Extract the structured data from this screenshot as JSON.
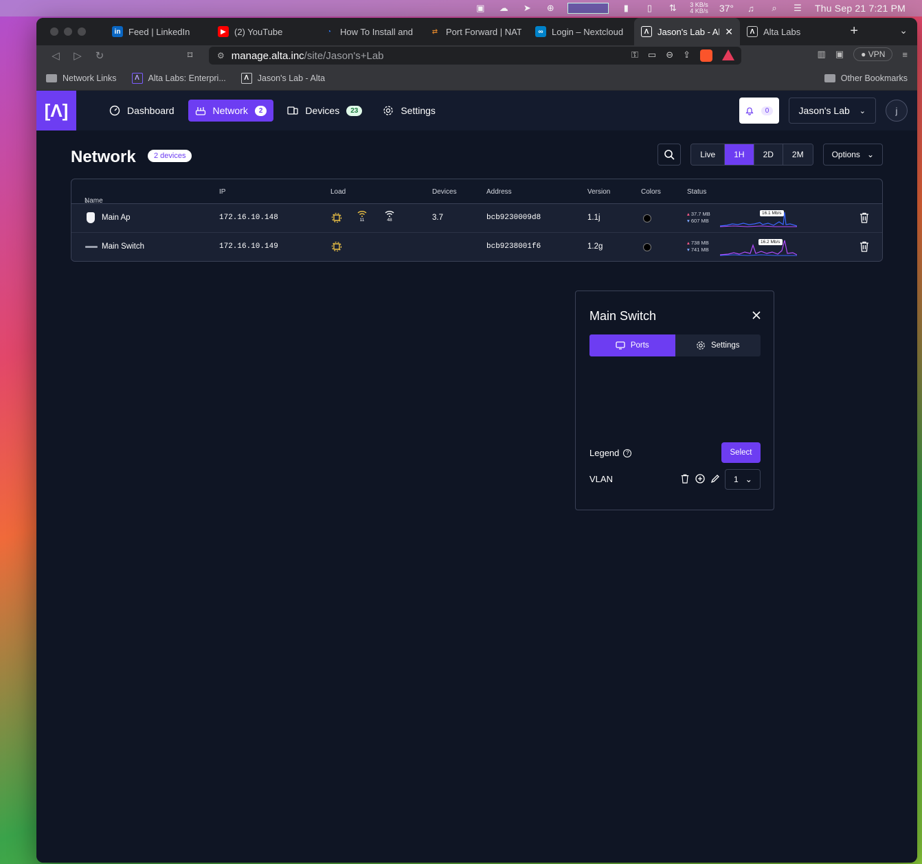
{
  "menubar": {
    "net_up": "3 KB/s",
    "net_down": "4 KB/s",
    "temp": "37°",
    "clock": "Thu Sep 21  7:21 PM"
  },
  "browser": {
    "tabs": [
      {
        "label": "Feed | LinkedIn",
        "fav": "in",
        "fav_bg": "#0a66c2"
      },
      {
        "label": "(2) YouTube",
        "fav": "▶",
        "fav_bg": "#ff0000"
      },
      {
        "label": "How To Install and C",
        "fav": "◔",
        "fav_bg": "#2f7bf6"
      },
      {
        "label": "Port Forward | NAT |",
        "fav": "⇄",
        "fav_bg": "#d9822b"
      },
      {
        "label": "Login – Nextcloud",
        "fav": "∞",
        "fav_bg": "#0082c9"
      },
      {
        "label": "Jason's Lab - Al",
        "fav": "Λ",
        "fav_bg": "#000000"
      },
      {
        "label": "Alta Labs",
        "fav": "Λ",
        "fav_bg": "#000000"
      }
    ],
    "url_domain": "manage.alta.inc",
    "url_path": "/site/Jason's+Lab",
    "vpn_label": "VPN",
    "bookmarks": [
      {
        "label": "Network Links"
      },
      {
        "label": "Alta Labs: Enterpri..."
      },
      {
        "label": "Jason's Lab - Alta"
      }
    ],
    "other_bookmarks": "Other Bookmarks"
  },
  "app": {
    "logo": "[Λ]",
    "nav": [
      {
        "label": "Dashboard",
        "icon": "gauge-icon"
      },
      {
        "label": "Network",
        "icon": "router-icon",
        "count": "2"
      },
      {
        "label": "Devices",
        "icon": "devices-icon",
        "count": "23"
      },
      {
        "label": "Settings",
        "icon": "gear-icon"
      }
    ],
    "notif_count": "0",
    "site_name": "Jason's Lab",
    "avatar": "j",
    "accent": "#6d3df2"
  },
  "page": {
    "title": "Network",
    "badge": "2 devices",
    "ranges": [
      "Live",
      "1H",
      "2D",
      "2M"
    ],
    "active_range": "1H",
    "options_label": "Options"
  },
  "table": {
    "columns": [
      "Name",
      "IP",
      "Load",
      "Devices",
      "Address",
      "Version",
      "Colors",
      "Status"
    ],
    "rows": [
      {
        "name": "Main Ap",
        "ip": "172.16.10.148",
        "wifi_2g": "11",
        "wifi_5g": "48",
        "devices": "3.7",
        "address": "bcb9230009d8",
        "version": "1.1j",
        "up": "37.7 MB",
        "down": "607 MB",
        "rate": "16.1 Mb/s"
      },
      {
        "name": "Main Switch",
        "ip": "172.16.10.149",
        "wifi_2g": "",
        "wifi_5g": "",
        "devices": "",
        "address": "bcb9238001f6",
        "version": "1.2g",
        "up": "738 MB",
        "down": "741 MB",
        "rate": "16.2 Mb/s"
      }
    ]
  },
  "panel": {
    "title": "Main Switch",
    "tabs": [
      "Ports",
      "Settings"
    ],
    "legend_label": "Legend",
    "select_label": "Select",
    "vlan_label": "VLAN",
    "vlan_value": "1"
  }
}
